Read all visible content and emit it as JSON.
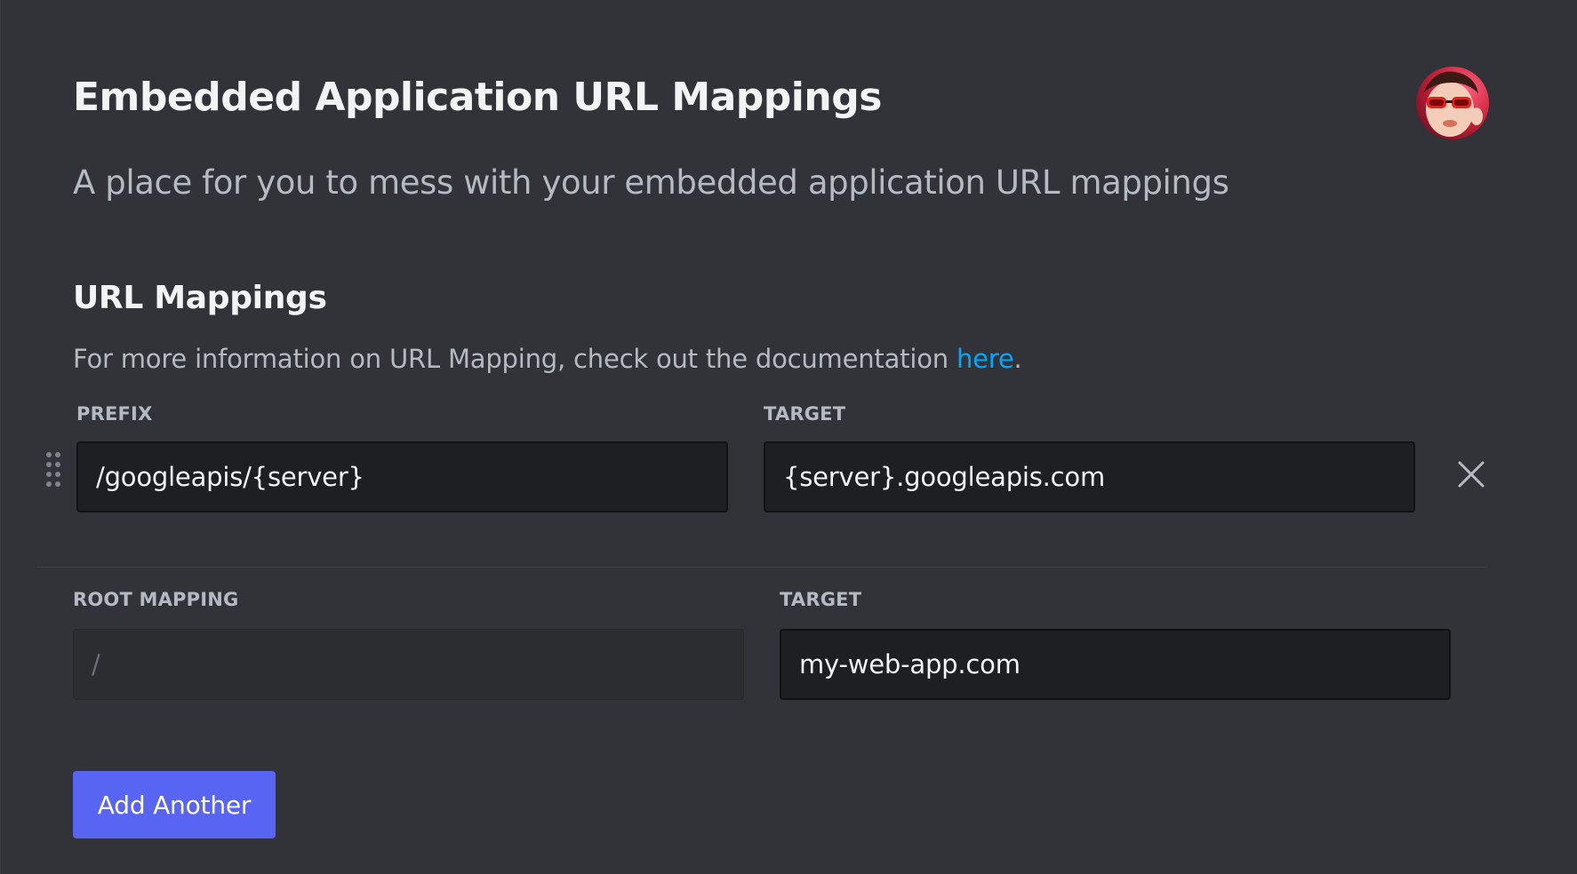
{
  "header": {
    "title": "Embedded Application URL Mappings",
    "subtitle": "A place for you to mess with your embedded application URL mappings"
  },
  "user": {
    "avatar_icon": "user-avatar-icon"
  },
  "url_mappings": {
    "title": "URL Mappings",
    "info_prefix": "For more information on URL Mapping, check out the documentation ",
    "info_link": "here",
    "info_suffix": ".",
    "prefix_label": "PREFIX",
    "target_label": "TARGET",
    "rows": [
      {
        "prefix": "/googleapis/{server}",
        "target": "{server}.googleapis.com"
      }
    ]
  },
  "root_mapping": {
    "label": "ROOT MAPPING",
    "target_label": "TARGET",
    "prefix_value": "/",
    "target_value": "my-web-app.com"
  },
  "actions": {
    "add_label": "Add Another"
  },
  "colors": {
    "background": "#313338",
    "input_bg": "#1e1f22",
    "accent": "#5865f2",
    "link": "#00a8fc"
  },
  "icons": {
    "drag": "drag-handle-icon",
    "remove": "close-icon"
  }
}
